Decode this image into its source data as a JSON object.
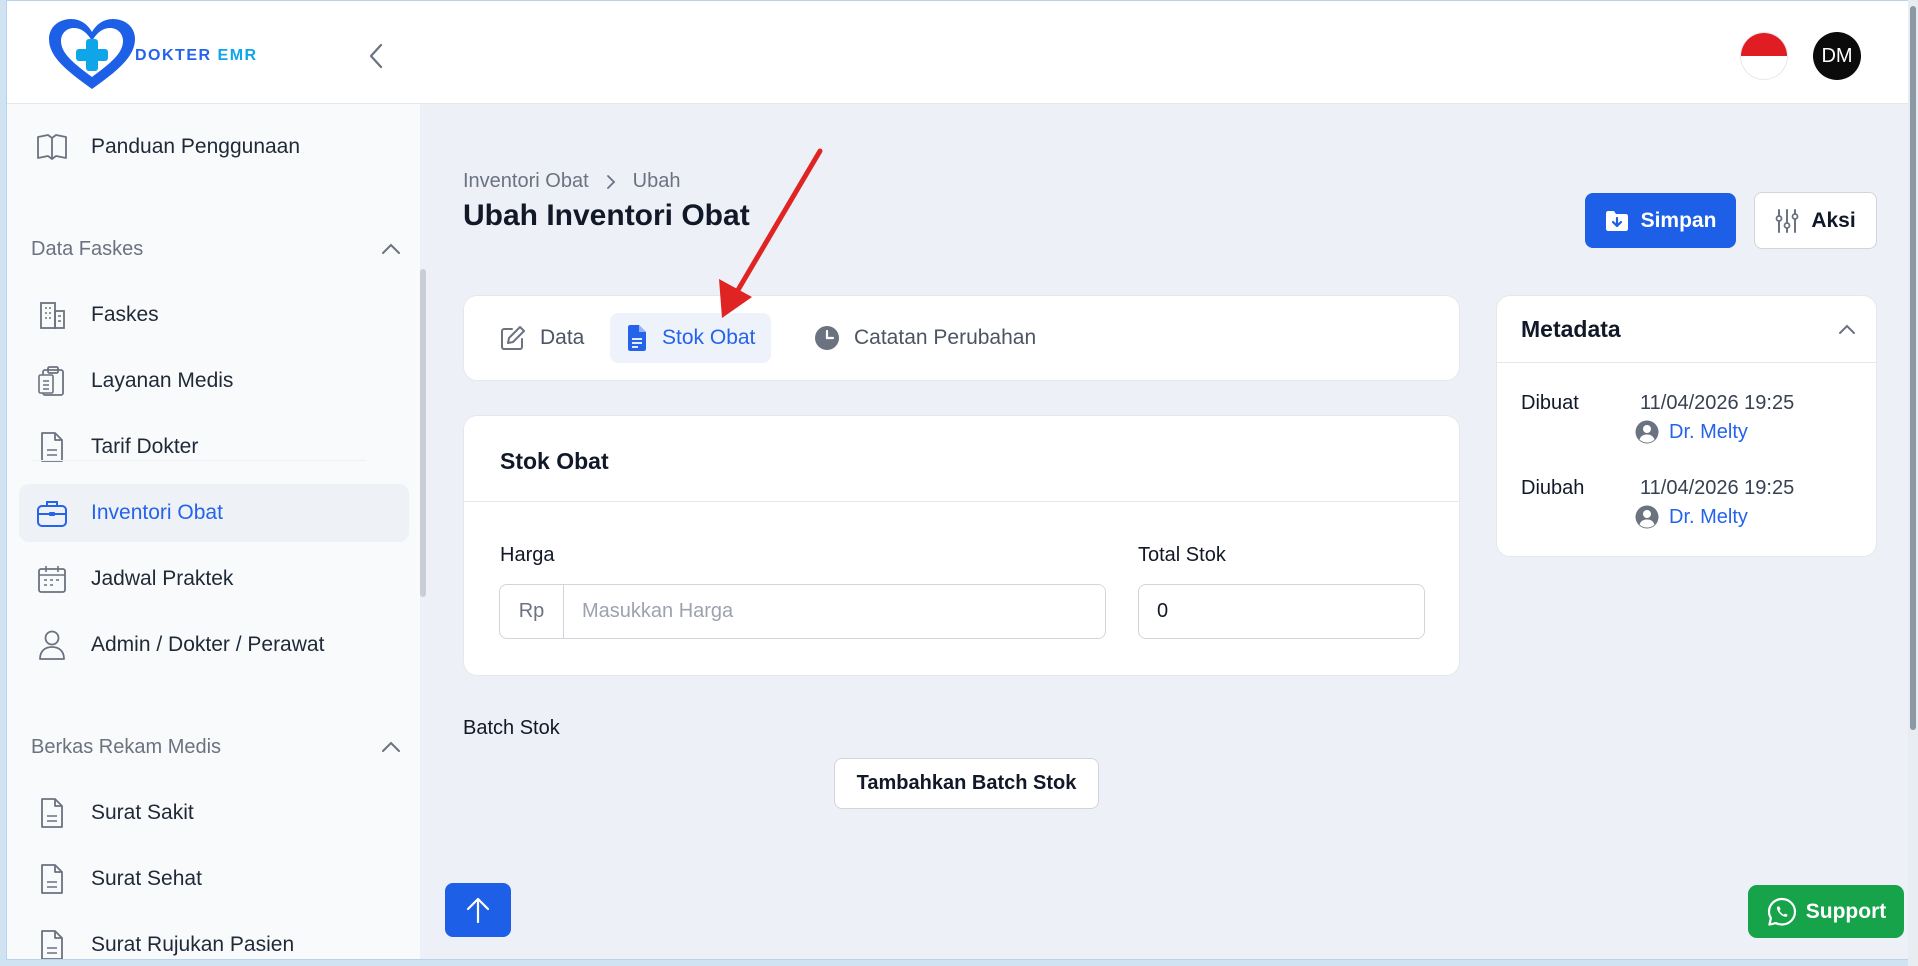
{
  "brand": {
    "name_part1": "DOKTER",
    "name_part2": "EMR"
  },
  "header": {
    "avatar_initials": "DM",
    "language_flag": "indonesia-flag"
  },
  "sidebar": {
    "items_top": [
      {
        "label": "Panduan Penggunaan",
        "icon": "book-icon"
      }
    ],
    "sections": [
      {
        "title": "Data Faskes",
        "items": [
          {
            "label": "Faskes",
            "icon": "building-icon"
          },
          {
            "label": "Layanan Medis",
            "icon": "clipboard-icon"
          },
          {
            "label": "Tarif Dokter",
            "icon": "document-icon"
          },
          {
            "label": "Inventori Obat",
            "icon": "briefcase-icon",
            "active": true
          },
          {
            "label": "Jadwal Praktek",
            "icon": "calendar-icon"
          },
          {
            "label": "Admin / Dokter / Perawat",
            "icon": "user-icon"
          }
        ]
      },
      {
        "title": "Berkas Rekam Medis",
        "items": [
          {
            "label": "Surat Sakit",
            "icon": "document-icon"
          },
          {
            "label": "Surat Sehat",
            "icon": "document-icon"
          },
          {
            "label": "Surat Rujukan Pasien",
            "icon": "document-icon"
          }
        ]
      }
    ]
  },
  "breadcrumb": {
    "parent": "Inventori Obat",
    "current": "Ubah"
  },
  "page": {
    "title": "Ubah Inventori Obat"
  },
  "actions": {
    "save_label": "Simpan",
    "actions_label": "Aksi"
  },
  "tabs": [
    {
      "label": "Data",
      "icon": "edit-icon"
    },
    {
      "label": "Stok Obat",
      "icon": "file-icon",
      "active": true
    },
    {
      "label": "Catatan Perubahan",
      "icon": "clock-icon"
    }
  ],
  "stok": {
    "title": "Stok Obat",
    "harga_label": "Harga",
    "currency_prefix": "Rp",
    "harga_placeholder": "Masukkan Harga",
    "total_stok_label": "Total Stok",
    "total_stok_value": "0"
  },
  "batch": {
    "label": "Batch Stok",
    "add_button": "Tambahkan Batch Stok"
  },
  "metadata": {
    "title": "Metadata",
    "rows": [
      {
        "key": "Dibuat",
        "time": "11/04/2026 19:25",
        "user": "Dr. Melty"
      },
      {
        "key": "Diubah",
        "time": "11/04/2026 19:25",
        "user": "Dr. Melty"
      }
    ]
  },
  "support": {
    "label": "Support"
  },
  "colors": {
    "primary": "#1d5fe6",
    "support": "#16a34a",
    "annotation_arrow": "#e02424"
  }
}
